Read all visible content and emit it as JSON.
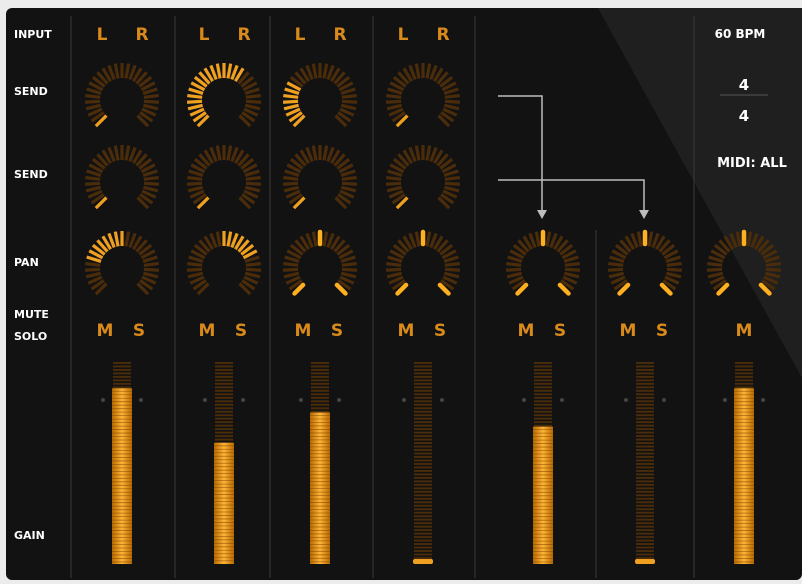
{
  "row_labels": {
    "input": "INPUT",
    "send1": "SEND",
    "send2": "SEND",
    "pan": "PAN",
    "mute": "MUTE",
    "solo": "SOLO",
    "gain": "GAIN"
  },
  "tempo": "60 BPM",
  "time_signature": {
    "numerator": "4",
    "denominator": "4"
  },
  "midi": "MIDI: ALL",
  "colors": {
    "accent": "#f0a020",
    "dim": "#4a2c0a",
    "background": "#121212"
  },
  "channels": [
    {
      "input_l": "L",
      "input_r": "R",
      "send1": 0.0,
      "send2": 0.0,
      "pan": -0.55,
      "mute": "M",
      "solo": "S",
      "gain": 0.87
    },
    {
      "input_l": "L",
      "input_r": "R",
      "send1": 0.65,
      "send2": 0.0,
      "pan": 0.5,
      "mute": "M",
      "solo": "S",
      "gain": 0.6
    },
    {
      "input_l": "L",
      "input_r": "R",
      "send1": 0.3,
      "send2": 0.0,
      "pan": 0.0,
      "mute": "M",
      "solo": "S",
      "gain": 0.75
    },
    {
      "input_l": "L",
      "input_r": "R",
      "send1": 0.0,
      "send2": 0.0,
      "pan": 0.0,
      "mute": "M",
      "solo": "S",
      "gain": 0.0
    }
  ],
  "returns": [
    {
      "pan": 0.0,
      "mute": "M",
      "solo": "S",
      "gain": 0.68
    },
    {
      "pan": 0.0,
      "mute": "M",
      "solo": "S",
      "gain": 0.0
    }
  ],
  "master": {
    "pan": 0.0,
    "mute": "M",
    "gain": 0.87
  }
}
